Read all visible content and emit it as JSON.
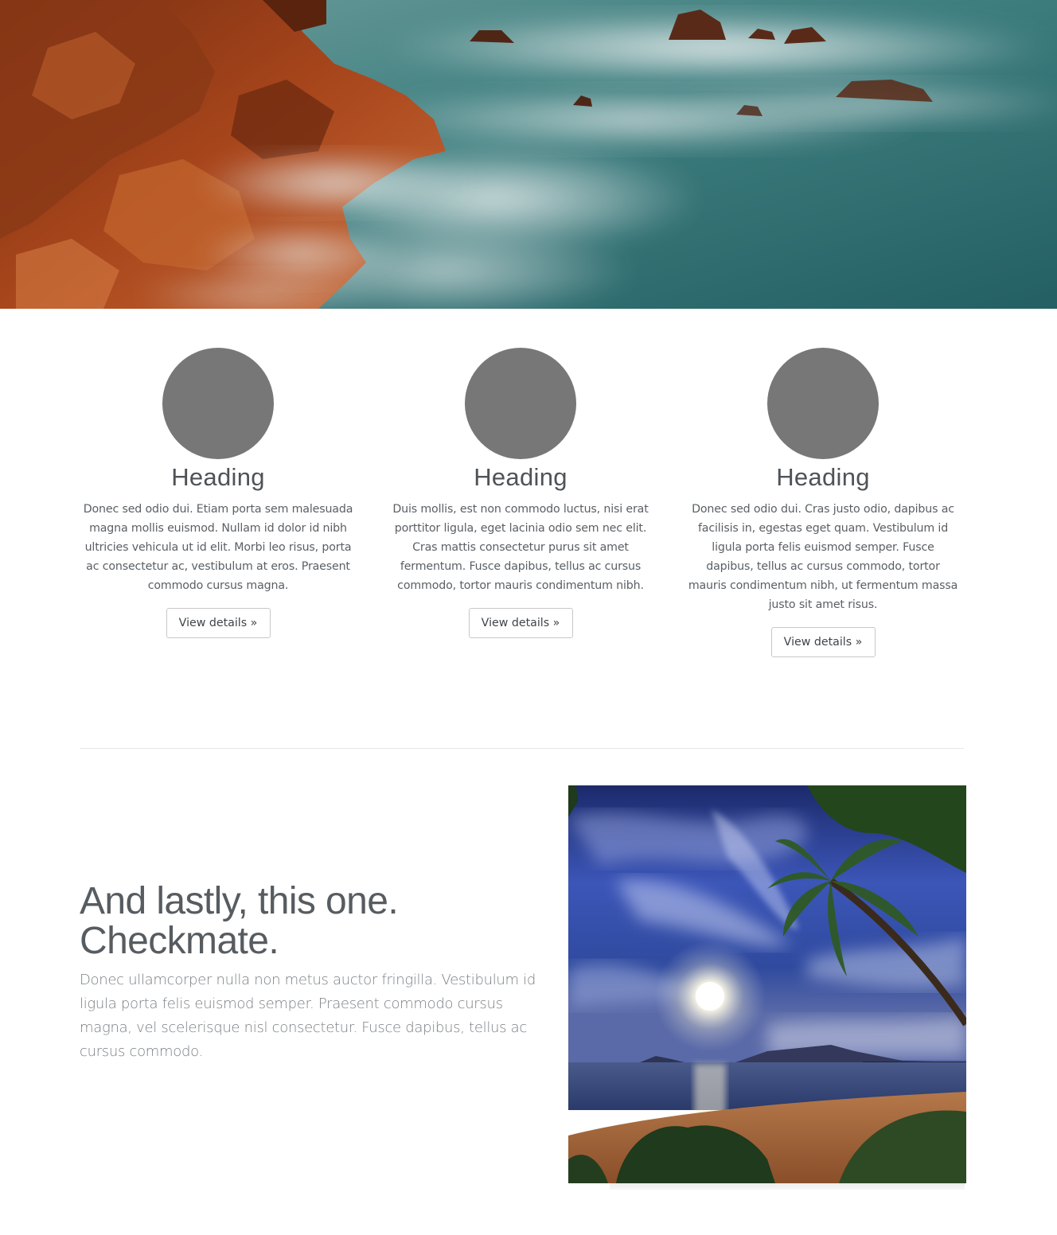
{
  "colors": {
    "circle_placeholder": "#777777",
    "heading_text": "#4e5358",
    "body_text": "#5a5f64",
    "button_border": "#c8c8c8",
    "divider": "#e6e7e8",
    "lead_text": "#7a7f84"
  },
  "hero": {
    "image_subject": "rocky-coastline-misty-sea"
  },
  "features": [
    {
      "heading": "Heading",
      "text": "Donec sed odio dui. Etiam porta sem malesuada magna mollis euismod. Nullam id dolor id nibh ultricies vehicula ut id elit. Morbi leo risus, porta ac consectetur ac, vestibulum at eros. Praesent commodo cursus magna.",
      "button_label": "View details »"
    },
    {
      "heading": "Heading",
      "text": "Duis mollis, est non commodo luctus, nisi erat porttitor ligula, eget lacinia odio sem nec elit. Cras mattis consectetur purus sit amet fermentum. Fusce dapibus, tellus ac cursus commodo, tortor mauris condimentum nibh.",
      "button_label": "View details »"
    },
    {
      "heading": "Heading",
      "text": "Donec sed odio dui. Cras justo odio, dapibus ac facilisis in, egestas eget quam. Vestibulum id ligula porta felis euismod semper. Fusce dapibus, tellus ac cursus commodo, tortor mauris condimentum nibh, ut fermentum massa justo sit amet risus.",
      "button_label": "View details »"
    }
  ],
  "featurette": {
    "heading": "And lastly, this one. Checkmate.",
    "lead": "Donec ullamcorper nulla non metus auctor fringilla. Vestibulum id ligula porta felis euismod semper. Praesent commodo cursus magna, vel scelerisque nisl consectetur. Fusce dapibus, tellus ac cursus commodo.",
    "image_subject": "tropical-beach-sunset-palm"
  }
}
